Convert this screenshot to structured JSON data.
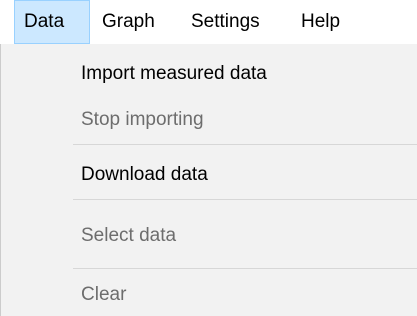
{
  "menubar": {
    "items": [
      {
        "label": "Data",
        "active": true
      },
      {
        "label": "Graph",
        "active": false
      },
      {
        "label": "Settings",
        "active": false
      },
      {
        "label": "Help",
        "active": false
      }
    ]
  },
  "dropdown": {
    "items": [
      {
        "label": "Import measured data",
        "enabled": true
      },
      {
        "label": "Stop importing",
        "enabled": false
      },
      {
        "label": "Download data",
        "enabled": true
      },
      {
        "label": "Select data",
        "enabled": false
      },
      {
        "label": "Clear",
        "enabled": false
      }
    ]
  },
  "colors": {
    "menubar_active_bg": "#cce8ff",
    "menubar_active_border": "#99d1ff",
    "dropdown_bg": "#f2f2f2",
    "disabled_text": "#6d6d6d",
    "separator": "#d7d7d7"
  }
}
